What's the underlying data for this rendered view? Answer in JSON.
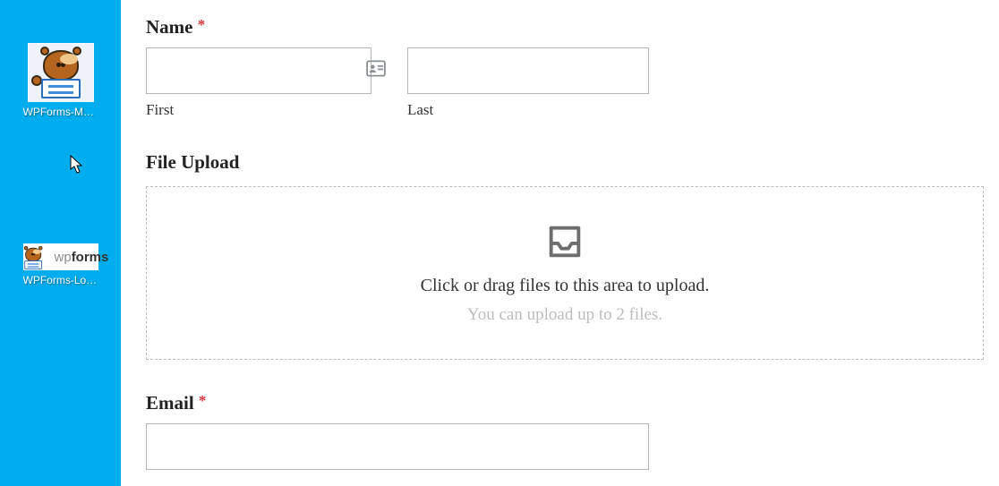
{
  "desktop": {
    "icon1_label": "WPForms-Mas...",
    "icon2_label": "WPForms-Log...",
    "logo_text_gray": "wp",
    "logo_text_bold": "forms"
  },
  "form": {
    "name": {
      "label": "Name",
      "required_marker": "*",
      "first_sublabel": "First",
      "last_sublabel": "Last",
      "first_value": "",
      "last_value": ""
    },
    "file_upload": {
      "label": "File Upload",
      "instruction": "Click or drag files to this area to upload.",
      "hint": "You can upload up to 2 files."
    },
    "email": {
      "label": "Email",
      "required_marker": "*",
      "value": ""
    }
  }
}
